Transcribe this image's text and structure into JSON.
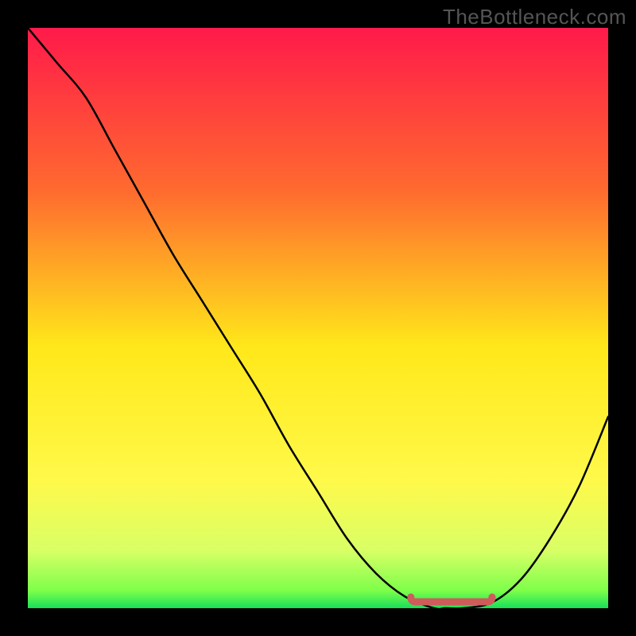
{
  "watermark": "TheBottleneck.com",
  "colors": {
    "bg": "#000000",
    "curve": "#000000",
    "flat_marker": "#cf5b5b",
    "grad_top": "#ff1a4a",
    "grad_mid_upper": "#ff8a1f",
    "grad_mid": "#ffe81a",
    "grad_mid_lower": "#f7ff60",
    "grad_near_bottom": "#9bff4a",
    "grad_bottom": "#18e05a"
  },
  "chart_data": {
    "type": "line",
    "title": "",
    "xlabel": "",
    "ylabel": "",
    "xlim": [
      0,
      100
    ],
    "ylim": [
      0,
      100
    ],
    "x": [
      0,
      5,
      10,
      15,
      20,
      25,
      30,
      35,
      40,
      45,
      50,
      55,
      60,
      65,
      70,
      72,
      75,
      80,
      85,
      90,
      95,
      100
    ],
    "series": [
      {
        "name": "bottleneck-curve",
        "values": [
          100,
          94,
          88,
          79,
          70,
          61,
          53,
          45,
          37,
          28,
          20,
          12,
          6,
          2,
          0,
          0,
          0,
          1,
          5,
          12,
          21,
          33
        ]
      }
    ],
    "flat_segment": {
      "x_start": 66,
      "x_end": 80,
      "y": 0
    }
  }
}
